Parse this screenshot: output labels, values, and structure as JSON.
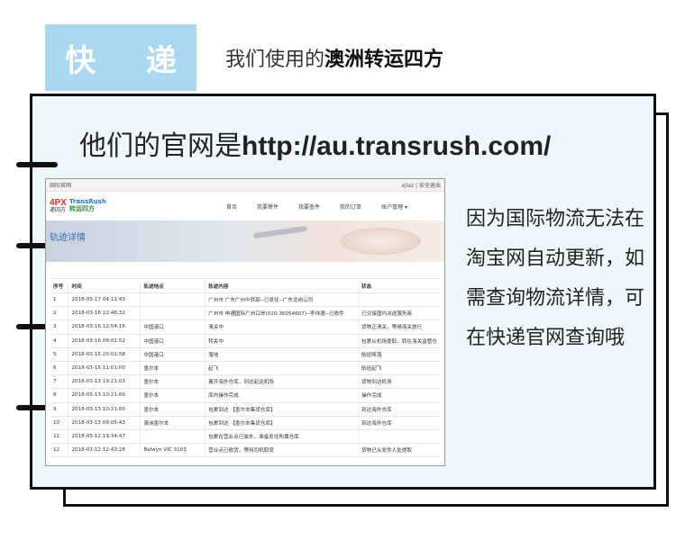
{
  "tag": {
    "label": "快 递"
  },
  "heading": {
    "prefix": "我们使用的",
    "highlight": "澳洲转运四方"
  },
  "website_line": {
    "prefix": "他们的官网是",
    "url": "http://au.transrush.com/"
  },
  "side_note": "因为国际物流无法在淘宝网自动更新，如需查询物流详情，可在快递官网查询哦",
  "screenshot": {
    "topbar": {
      "left": "国际官网",
      "right": "xjlaz  |  安全退出"
    },
    "logo": {
      "brand1": "4PX",
      "brand1_sub": "递四方",
      "brand2": "TransRush",
      "brand2_sub": "转运四方"
    },
    "nav": [
      "首页",
      "我要寄件",
      "我要查件",
      "我的订单",
      "账户管理"
    ],
    "banner_title": "轨迹详情",
    "table": {
      "headers": [
        "序号",
        "时间",
        "轨迹地点",
        "轨迹内容",
        "状态"
      ],
      "rows": [
        [
          "1",
          "2018-03-17 04:11:43",
          "",
          "广州市 广东广州中转部--已发往--广东龙岗公司",
          ""
        ],
        [
          "2",
          "2018-03-16 22:46:32",
          "",
          "广州市 申通国际广州口岸(020-36054607)--李伟德--已收件",
          "已交接国内派送服务商"
        ],
        [
          "3",
          "2018-03-16 12:54:16",
          "中国港口",
          "清关中",
          "货物正清关，等候海关放行"
        ],
        [
          "4",
          "2018-03-16 09:02:52",
          "中国港口",
          "转关中",
          "包裹从机场提取，转往海关监管仓"
        ],
        [
          "5",
          "2018-03-15 20:01:58",
          "中国港口",
          "落地",
          "航班降落"
        ],
        [
          "6",
          "2018-03-15 11:01:00",
          "墨尔本",
          "起飞",
          "航班起飞"
        ],
        [
          "7",
          "2018-03-13 19:21:03",
          "墨尔本",
          "离开海外仓库，到达起运机场",
          "货物到达机场"
        ],
        [
          "8",
          "2018-03-13 10:21:00",
          "墨尔本",
          "库内操作完成",
          "操作完成"
        ],
        [
          "9",
          "2018-03-13 10:21:00",
          "墨尔本",
          "包裹到达 【墨尔本集货仓库】",
          "到达海外仓库"
        ],
        [
          "10",
          "2018-03-13 09:05:43",
          "澳洲墨尔本",
          "包裹到达 【墨尔本集货仓库】",
          "到达海外仓库"
        ],
        [
          "11",
          "2018-03-12 19:34:47",
          "",
          "包裹在营业点已装车，准备发往所属仓库",
          ""
        ],
        [
          "12",
          "2018-03-12 12:43:28",
          "Balwyn VIC 3103",
          "营业点已收货，等待司机取货",
          "货物已从发件人处提取"
        ]
      ]
    }
  }
}
